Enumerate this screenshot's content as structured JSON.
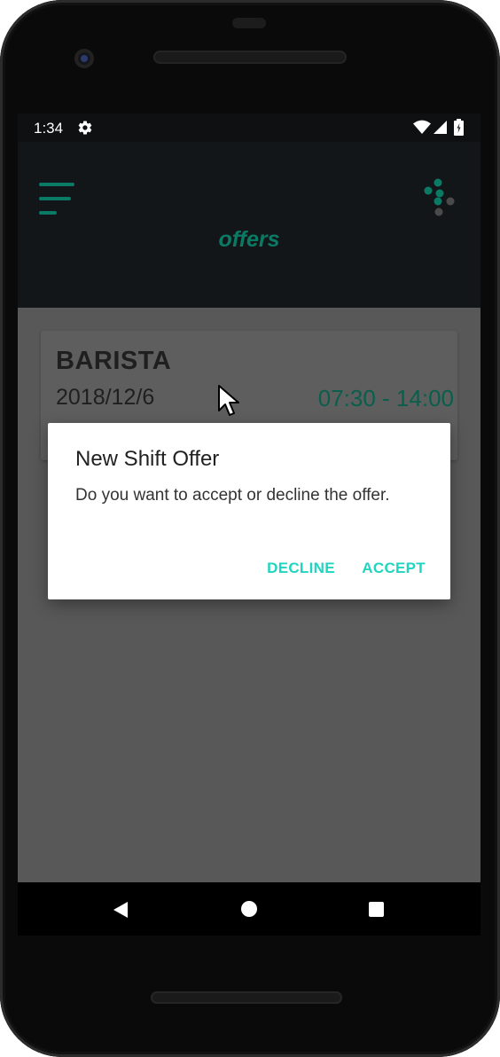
{
  "status_bar": {
    "time": "1:34",
    "icons": [
      "settings-icon",
      "wifi-icon",
      "signal-icon",
      "battery-icon"
    ]
  },
  "app_bar": {
    "title": "offers",
    "menu_icon": "menu-icon",
    "app_icon": "app-logo-icon"
  },
  "offer_card": {
    "role": "BARISTA",
    "date": "2018/12/6",
    "time_range": "07:30 - 14:00"
  },
  "dialog": {
    "title": "New Shift Offer",
    "message": "Do you want to accept or decline the offer.",
    "decline_label": "DECLINE",
    "accept_label": "ACCEPT"
  },
  "nav_bar": {
    "icons": [
      "back-icon",
      "home-icon",
      "recents-icon"
    ]
  },
  "colors": {
    "accent": "#1ed6c0",
    "brand_green": "#0b7a64",
    "app_bar_bg": "#131618",
    "scrim_bg": "#585858"
  }
}
